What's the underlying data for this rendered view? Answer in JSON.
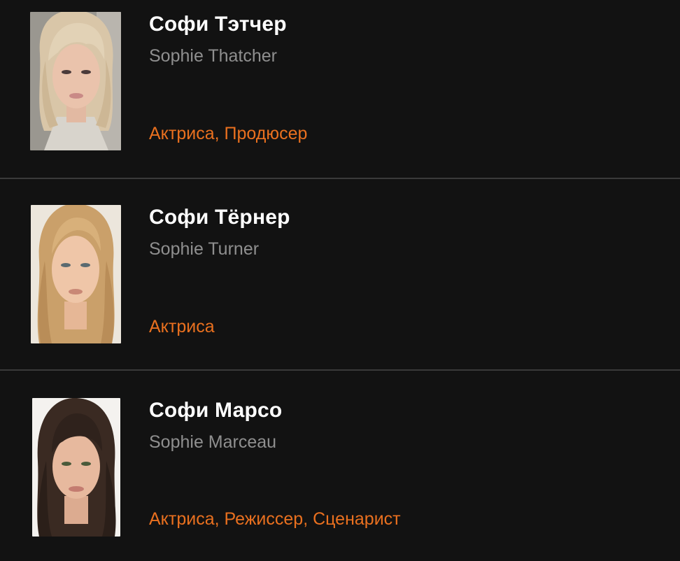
{
  "people": [
    {
      "name": "Софи Тэтчер",
      "original_name": "Sophie Thatcher",
      "roles": "Актриса, Продюсер",
      "hair_color": "#d9c6a8",
      "background_color": "#9a9790"
    },
    {
      "name": "Софи Тёрнер",
      "original_name": "Sophie Turner",
      "roles": "Актриса",
      "hair_color": "#caa06a",
      "background_color": "#ece6dc"
    },
    {
      "name": "Софи Марсо",
      "original_name": "Sophie Marceau",
      "roles": "Актриса, Режиссер, Сценарист",
      "hair_color": "#3a2a22",
      "background_color": "#f4f2ef"
    }
  ],
  "colors": {
    "background": "#121212",
    "divider": "#3a3a3a",
    "name": "#ffffff",
    "original_name": "#8f8f8f",
    "roles_accent": "#e9701f"
  }
}
